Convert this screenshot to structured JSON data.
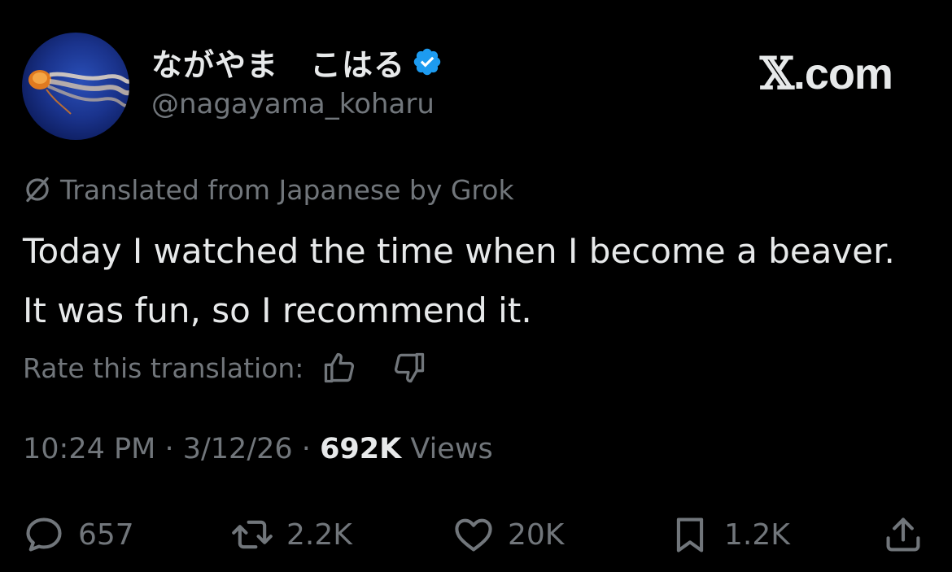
{
  "user": {
    "display_name": "ながやま　こはる",
    "handle": "@nagayama_koharu",
    "verified_badge_icon": "verified-badge-icon",
    "verified_color": "#1d9bf0",
    "avatar_icon": "jellyfish-avatar"
  },
  "watermark": {
    "x_glyph": "𝕏",
    "domain": ".com"
  },
  "translation": {
    "notice": "Translated from Japanese by Grok",
    "icon": "grok-icon",
    "rate_label": "Rate this translation:",
    "thumbs_up_icon": "thumbs-up-icon",
    "thumbs_down_icon": "thumbs-down-icon"
  },
  "tweet": {
    "text": "Today I watched the time when I become a beaver. It was fun, so I recommend it."
  },
  "meta": {
    "time": "10:24 PM",
    "separator": "·",
    "date": "3/12/26",
    "views_count": "692K",
    "views_label": "Views"
  },
  "actions": {
    "replies": "657",
    "reposts": "2.2K",
    "likes": "20K",
    "bookmarks": "1.2K"
  },
  "colors": {
    "background": "#000000",
    "primary_text": "#e7e9ea",
    "secondary_text": "#71767b",
    "accent": "#1d9bf0"
  }
}
